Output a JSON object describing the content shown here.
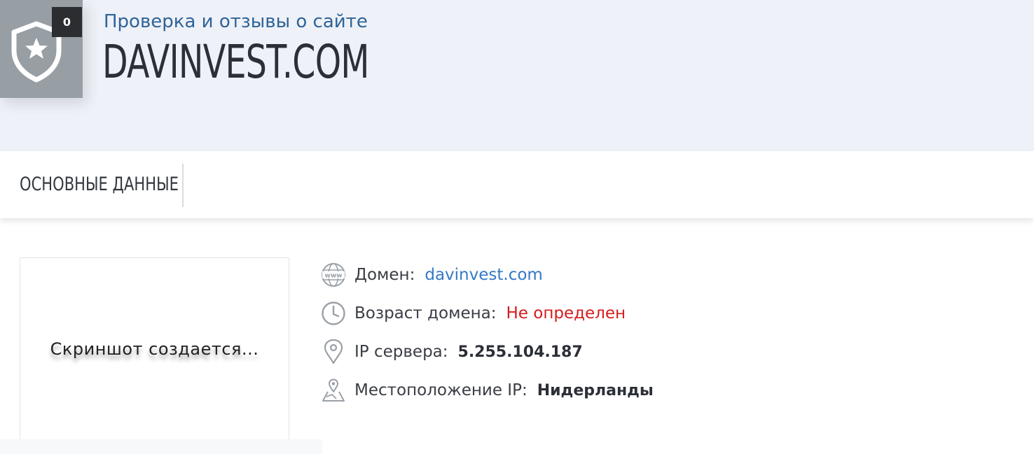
{
  "header": {
    "badge_count": "0",
    "subtitle": "Проверка и отзывы о сайте",
    "site_name": "DAVINVEST.COM"
  },
  "nav": {
    "tabs": [
      {
        "label": "ОСНОВНЫЕ ДАННЫЕ"
      }
    ]
  },
  "screenshot": {
    "placeholder": "Скриншот создается..."
  },
  "info": {
    "domain": {
      "label": "Домен:",
      "value": "davinvest.com",
      "icon": "www-globe-icon"
    },
    "age": {
      "label": "Возраст домена:",
      "value": "Не определен",
      "icon": "clock-icon"
    },
    "ip": {
      "label": "IP сервера:",
      "value": "5.255.104.187",
      "icon": "map-pin-icon"
    },
    "location": {
      "label": "Местоположение IP:",
      "value": "Нидерланды",
      "icon": "map-location-icon"
    }
  },
  "colors": {
    "header_bg": "#eef1f8",
    "shield_bg": "#979ea4",
    "subtitle": "#2f6496",
    "link": "#3579c4",
    "warning": "#d41c1c"
  }
}
